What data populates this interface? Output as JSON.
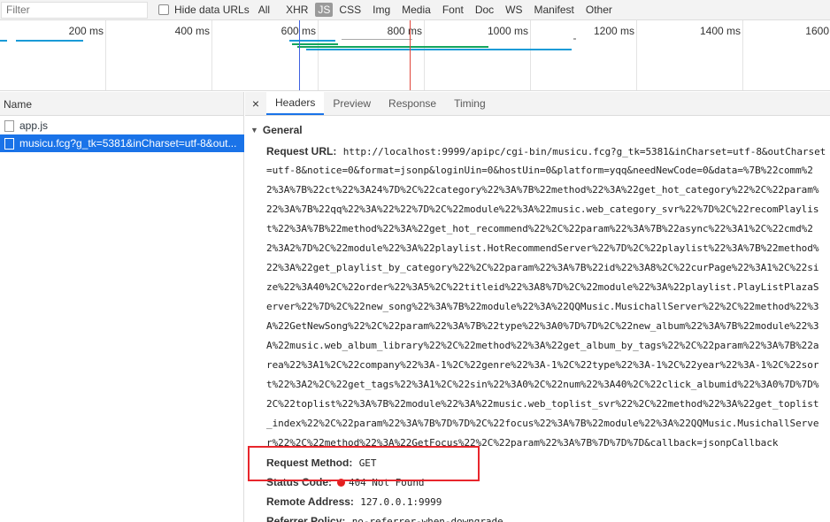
{
  "filterbar": {
    "filter_placeholder": "Filter",
    "hide_data_urls_label": "Hide data URLs",
    "types": [
      "All",
      "XHR",
      "JS",
      "CSS",
      "Img",
      "Media",
      "Font",
      "Doc",
      "WS",
      "Manifest",
      "Other"
    ],
    "active_type": "JS"
  },
  "overview": {
    "ticks": [
      "200 ms",
      "400 ms",
      "600 ms",
      "800 ms",
      "1000 ms",
      "1200 ms",
      "1400 ms",
      "1600"
    ],
    "colors": {
      "blue": "#1a9bd7",
      "green": "#13a55d",
      "red": "#e0453a",
      "gray": "#a9a9a9"
    }
  },
  "list": {
    "header": "Name",
    "rows": [
      {
        "name": "app.js",
        "selected": false
      },
      {
        "name": "musicu.fcg?g_tk=5381&inCharset=utf-8&out...",
        "selected": true
      }
    ]
  },
  "tabs": {
    "close": "×",
    "items": [
      "Headers",
      "Preview",
      "Response",
      "Timing"
    ],
    "active": "Headers"
  },
  "general": {
    "title": "General",
    "request_url_label": "Request URL:",
    "request_url_lines": [
      "http://localhost:9999/apipc/cgi-bin/musicu.fcg?g_tk=5381&inCharset=utf-8&outCharset",
      "=utf-8&notice=0&format=jsonp&loginUin=0&hostUin=0&platform=yqq&needNewCode=0&data=%7B%22comm%2",
      "2%3A%7B%22ct%22%3A24%7D%2C%22category%22%3A%7B%22method%22%3A%22get_hot_category%22%2C%22param%",
      "22%3A%7B%22qq%22%3A%22%22%7D%2C%22module%22%3A%22music.web_category_svr%22%7D%2C%22recomPlaylis",
      "t%22%3A%7B%22method%22%3A%22get_hot_recommend%22%2C%22param%22%3A%7B%22async%22%3A1%2C%22cmd%2",
      "2%3A2%7D%2C%22module%22%3A%22playlist.HotRecommendServer%22%7D%2C%22playlist%22%3A%7B%22method%",
      "22%3A%22get_playlist_by_category%22%2C%22param%22%3A%7B%22id%22%3A8%2C%22curPage%22%3A1%2C%22si",
      "ze%22%3A40%2C%22order%22%3A5%2C%22titleid%22%3A8%7D%2C%22module%22%3A%22playlist.PlayListPlazaS",
      "erver%22%7D%2C%22new_song%22%3A%7B%22module%22%3A%22QQMusic.MusichallServer%22%2C%22method%22%3",
      "A%22GetNewSong%22%2C%22param%22%3A%7B%22type%22%3A0%7D%7D%2C%22new_album%22%3A%7B%22module%22%3",
      "A%22music.web_album_library%22%2C%22method%22%3A%22get_album_by_tags%22%2C%22param%22%3A%7B%22a",
      "rea%22%3A1%2C%22company%22%3A-1%2C%22genre%22%3A-1%2C%22type%22%3A-1%2C%22year%22%3A-1%2C%22sor",
      "t%22%3A2%2C%22get_tags%22%3A1%2C%22sin%22%3A0%2C%22num%22%3A40%2C%22click_albumid%22%3A0%7D%7D%",
      "2C%22toplist%22%3A%7B%22module%22%3A%22music.web_toplist_svr%22%2C%22method%22%3A%22get_toplist",
      "_index%22%2C%22param%22%3A%7B%7D%7D%2C%22focus%22%3A%7B%22module%22%3A%22QQMusic.MusichallServe",
      "r%22%2C%22method%22%3A%22GetFocus%22%2C%22param%22%3A%7B%7D%7D%7D&callback=jsonpCallback"
    ],
    "request_method_label": "Request Method:",
    "request_method": "GET",
    "status_code_label": "Status Code:",
    "status_code": "404 Not Found",
    "status_color": "#e41f1f",
    "remote_address_label": "Remote Address:",
    "remote_address": "127.0.0.1:9999",
    "referrer_policy_label": "Referrer Policy:",
    "referrer_policy": "no-referrer-when-downgrade"
  }
}
